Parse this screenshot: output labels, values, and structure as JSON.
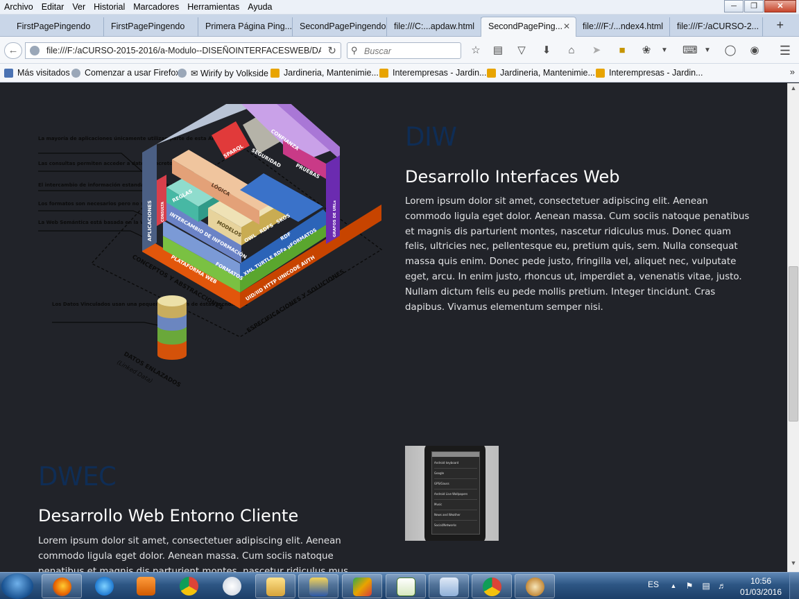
{
  "menubar": {
    "items": [
      "Archivo",
      "Editar",
      "Ver",
      "Historial",
      "Marcadores",
      "Herramientas",
      "Ayuda"
    ]
  },
  "tabs": [
    {
      "label": "FirstPagePingendo",
      "active": false
    },
    {
      "label": "FirstPagePingendo",
      "active": false
    },
    {
      "label": "Primera Página Ping...",
      "active": false
    },
    {
      "label": "SecondPagePingendo",
      "active": false
    },
    {
      "label": "file:///C:...apdaw.html",
      "active": false
    },
    {
      "label": "SecondPagePing...",
      "active": true
    },
    {
      "label": "file:///F:/...ndex4.html",
      "active": false
    },
    {
      "label": "file:///F:/aCURSO-2...",
      "active": false
    }
  ],
  "navbar": {
    "url": "file:///F:/aCURSO-2015-2016/a-Modulo--DISEÑOINTERFACESWEB/DA",
    "search_placeholder": "Buscar"
  },
  "bookmarks": [
    {
      "label": "Más visitados",
      "icon": "star-icon"
    },
    {
      "label": "Comenzar a usar Firefox",
      "icon": "globe-icon"
    },
    {
      "label": "✉ Wirify by Volkside",
      "icon": "globe-icon"
    },
    {
      "label": "Jardineria, Mantenimie...",
      "icon": "feed-icon"
    },
    {
      "label": "Interempresas - Jardin...",
      "icon": "feed-icon"
    },
    {
      "label": "Jardineria, Mantenimie...",
      "icon": "feed-icon"
    },
    {
      "label": "Interempresas - Jardin...",
      "icon": "feed-icon"
    }
  ],
  "sections": {
    "diw": {
      "abbr": "DIW",
      "title": "Desarrollo Interfaces Web",
      "body": "Lorem ipsum dolor sit amet, consectetuer adipiscing elit. Aenean commodo ligula eget dolor. Aenean massa. Cum sociis natoque penatibus et magnis dis parturient montes, nascetur ridiculus mus. Donec quam felis, ultricies nec, pellentesque eu, pretium quis, sem. Nulla consequat massa quis enim. Donec pede justo, fringilla vel, aliquet nec, vulputate eget, arcu. In enim justo, rhoncus ut, imperdiet a, venenatis vitae, justo. Nullam dictum felis eu pede mollis pretium. Integer tincidunt. Cras dapibus. Vivamus elementum semper nisi."
    },
    "dwec": {
      "abbr": "DWEC",
      "title": "Desarrollo Web Entorno Cliente",
      "body": "Lorem ipsum dolor sit amet, consectetuer adipiscing elit. Aenean commodo ligula eget dolor. Aenean massa. Cum sociis natoque penatibus et magnis dis parturient montes, nascetur ridiculus mus. Donec quam felis, ultricies nec,"
    }
  },
  "diagram": {
    "left_notes": [
      "La mayoría de aplicaciones únicamente utilizan parte de esta Arquitectura",
      "Las consultas permiten acceder a datos concretos",
      "El intercambio de información estandarizada es clave",
      "Los formatos son necesarios pero no son lo más importante",
      "La Web Semántica está basada en la Web"
    ],
    "db_note": "Los Datos Vinculados usan una pequeña selección de éstas tecnologías",
    "blocks": {
      "aplicaciones": "APLICACIONES",
      "consulta": "CONSULTA",
      "reglas": "REGLAS",
      "logica": "LÓGICA",
      "sparql": "SPARQL",
      "seguridad": "SEGURIDAD",
      "confianza": "CONFIANZA",
      "pruebas": "PRUEBAS",
      "grafos": "GRAFOS DE URLs",
      "modelos": "MODELOS",
      "owl": "OWL",
      "rdfs": "RDFS",
      "skos": "SKOS",
      "rdf": "RDF",
      "intercambio": "INTERCAMBIO DE INFORMACIÓN",
      "formatos": "FORMATOS",
      "serializaciones": "XML TURTLE RDFa μFORMATOS",
      "plataforma": "PLATAFORMA WEB",
      "protocolos": "UID/IID HTTP UNICODE AUTH",
      "conceptos": "CONCEPTOS Y ABSTRACCIONES",
      "especificaciones": "ESPECIFICACIONES Y SOLUCIONES",
      "datos": "DATOS ENLAZADOS",
      "linked": "(Linked Data)"
    }
  },
  "phone_list": [
    "Android keyboard",
    "Google",
    "GPS/Gauss",
    "Android Live Wallpapers",
    "Music",
    "News and Weather",
    "Social/Networks"
  ],
  "taskbar": {
    "apps": [
      "firefox-icon",
      "ie-icon",
      "media-player-icon",
      "chrome-icon",
      "paint-icon",
      "explorer-icon",
      "network-icon",
      "scan-icon",
      "notepad-icon",
      "windows-icon",
      "chrome-icon",
      "paintbrush-icon"
    ],
    "lang": "ES",
    "time": "10:56",
    "date": "01/03/2016"
  },
  "colors": {
    "page_bg": "#212329",
    "abbr": "#0f2d55",
    "text": "#e3e4e6"
  }
}
